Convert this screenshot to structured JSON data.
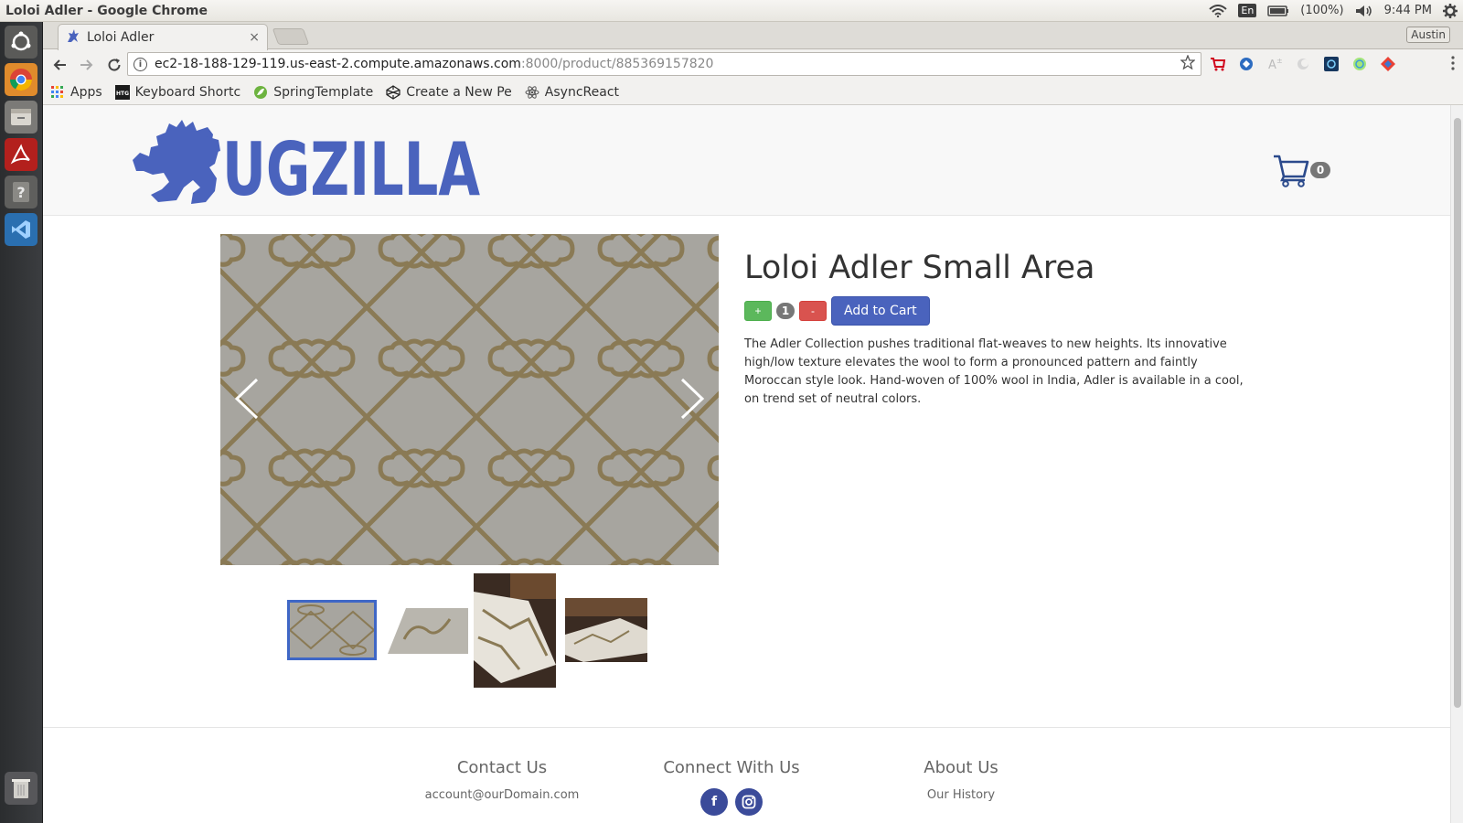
{
  "os": {
    "window_title": "Loloi Adler - Google Chrome",
    "language": "En",
    "battery": "(100%)",
    "clock": "9:44 PM"
  },
  "browser": {
    "tab_title": "Loloi Adler",
    "tab_close": "×",
    "profile_name": "Austin",
    "url_host": "ec2-18-188-129-119.us-east-2.compute.amazonaws.com",
    "url_rest": ":8000/product/885369157820",
    "bookmarks": [
      {
        "label": "Apps",
        "icon": "apps-grid-icon"
      },
      {
        "label": "Keyboard Shortc",
        "icon": "htg-icon"
      },
      {
        "label": "SpringTemplate",
        "icon": "spring-icon"
      },
      {
        "label": "Create a New Pe",
        "icon": "codepen-icon"
      },
      {
        "label": "AsyncReact",
        "icon": "react-icon"
      }
    ]
  },
  "site": {
    "logo_text": "UGZILLA",
    "cart_count": "0",
    "brand_color": "#4a63bd"
  },
  "product": {
    "title": "Loloi Adler Small Area",
    "plus_label": "+",
    "minus_label": "-",
    "quantity": "1",
    "add_to_cart_label": "Add to Cart",
    "description": "The Adler Collection pushes traditional flat-weaves to new heights. Its innovative high/low texture elevates the wool to form a pronounced pattern and faintly Moroccan style look. Hand-woven of 100% wool in India, Adler is available in a cool, on trend set of neutral colors.",
    "thumbnails_count": 4,
    "selected_thumbnail": 1
  },
  "footer": {
    "contact_heading": "Contact Us",
    "contact_email": "account@ourDomain.com",
    "connect_heading": "Connect With Us",
    "facebook_glyph": "f",
    "about_heading": "About Us",
    "about_link": "Our History"
  }
}
